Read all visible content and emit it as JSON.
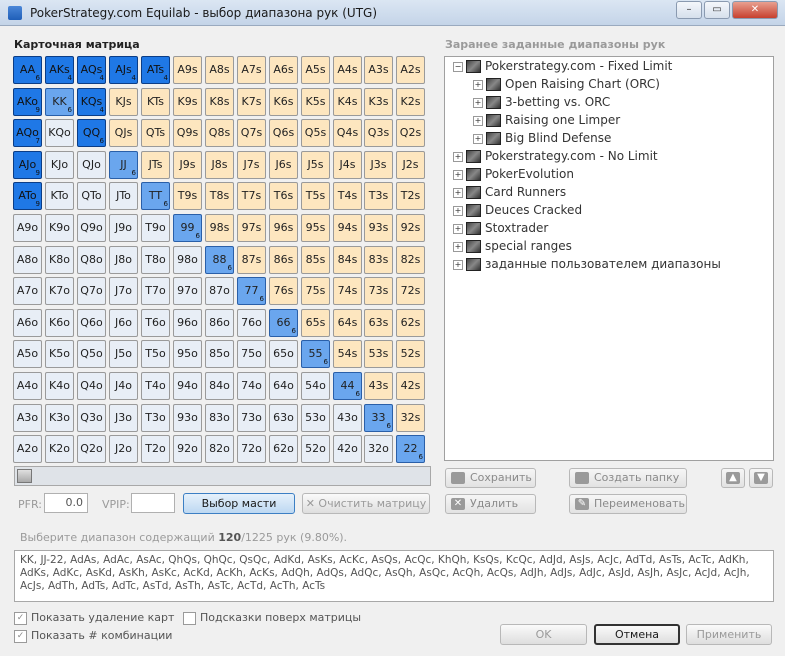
{
  "window": {
    "title": "PokerStrategy.com Equilab - выбор диапазона рук (UTG)",
    "min_label": "–",
    "max_label": "▭",
    "close_label": "✕"
  },
  "matrix": {
    "label": "Карточная матрица",
    "ranks": [
      "A",
      "K",
      "Q",
      "J",
      "T",
      "9",
      "8",
      "7",
      "6",
      "5",
      "4",
      "3",
      "2"
    ],
    "selected": {
      "AA": {
        "state": "full",
        "count": "6"
      },
      "AKs": {
        "state": "full",
        "count": "4"
      },
      "AQs": {
        "state": "full",
        "count": "4"
      },
      "AJs": {
        "state": "full",
        "count": "4"
      },
      "ATs": {
        "state": "full",
        "count": "4"
      },
      "AKo": {
        "state": "full",
        "count": "9"
      },
      "KK": {
        "state": "half",
        "count": "6"
      },
      "KQs": {
        "state": "full",
        "count": "4"
      },
      "AQo": {
        "state": "full",
        "count": "7"
      },
      "QQ": {
        "state": "full",
        "count": "6"
      },
      "AJo": {
        "state": "full",
        "count": "9"
      },
      "JJ": {
        "state": "half",
        "count": "6"
      },
      "ATo": {
        "state": "full",
        "count": "9"
      },
      "TT": {
        "state": "half",
        "count": "6"
      },
      "99": {
        "state": "half",
        "count": "6"
      },
      "88": {
        "state": "half",
        "count": "6"
      },
      "77": {
        "state": "half",
        "count": "6"
      },
      "66": {
        "state": "half",
        "count": "6"
      },
      "55": {
        "state": "half",
        "count": "6"
      },
      "44": {
        "state": "half",
        "count": "6"
      },
      "33": {
        "state": "half",
        "count": "6"
      },
      "22": {
        "state": "half",
        "count": "6"
      }
    }
  },
  "presets": {
    "label": "Заранее заданные диапазоны рук",
    "tree": [
      {
        "label": "Pokerstrategy.com - Fixed Limit",
        "level": 0,
        "expander": "−"
      },
      {
        "label": "Open Raising Chart (ORC)",
        "level": 1,
        "expander": "+"
      },
      {
        "label": "3-betting vs. ORC",
        "level": 1,
        "expander": "+"
      },
      {
        "label": "Raising one Limper",
        "level": 1,
        "expander": "+"
      },
      {
        "label": "Big Blind Defense",
        "level": 1,
        "expander": "+"
      },
      {
        "label": "Pokerstrategy.com - No Limit",
        "level": 0,
        "expander": "+"
      },
      {
        "label": "PokerEvolution",
        "level": 0,
        "expander": "+"
      },
      {
        "label": "Card Runners",
        "level": 0,
        "expander": "+"
      },
      {
        "label": "Deuces Cracked",
        "level": 0,
        "expander": "+"
      },
      {
        "label": "Stoxtrader",
        "level": 0,
        "expander": "+"
      },
      {
        "label": "special ranges",
        "level": 0,
        "expander": "+"
      },
      {
        "label": "заданные пользователем диапазоны",
        "level": 0,
        "expander": "+"
      }
    ],
    "save_label": "Сохранить",
    "create_folder_label": "Создать папку",
    "delete_label": "Удалить",
    "rename_label": "Переименовать"
  },
  "controls": {
    "pfr_label": "PFR:",
    "pfr_value": "0.0",
    "vpip_label": "VPIP:",
    "vpip_value": "",
    "suit_select_label": "Выбор масти",
    "clear_matrix_label": "Очистить матрицу"
  },
  "summary": {
    "prefix": "Выберите диапазон содержащий ",
    "count": "120",
    "suffix": "/1225 рук (9.80%)."
  },
  "range_text": "KK, JJ-22, AdAs, AdAc, AsAc, QhQs, QhQc, QsQc, AdKd, AsKs, AcKc, AsQs, AcQc, KhQh, KsQs, KcQc, AdJd, AsJs, AcJc, AdTd, AsTs, AcTc, AdKh, AdKs, AdKc, AsKd, AsKh, AsKc, AcKd, AcKh, AcKs, AdQh, AdQs, AdQc, AsQh, AsQc, AcQh, AcQs, AdJh, AdJs, AdJc, AsJd, AsJh, AsJc, AcJd, AcJh, AcJs, AdTh, AdTs, AdTc, AsTd, AsTh, AsTc, AcTd, AcTh, AcTs",
  "options": {
    "show_removal_label": "Показать удаление карт",
    "hints_label": "Подсказки поверх матрицы",
    "show_combos_label": "Показать # комбинации",
    "check_mark": "✓"
  },
  "dialog": {
    "ok_label": "OK",
    "cancel_label": "Отмена",
    "apply_label": "Применить"
  }
}
